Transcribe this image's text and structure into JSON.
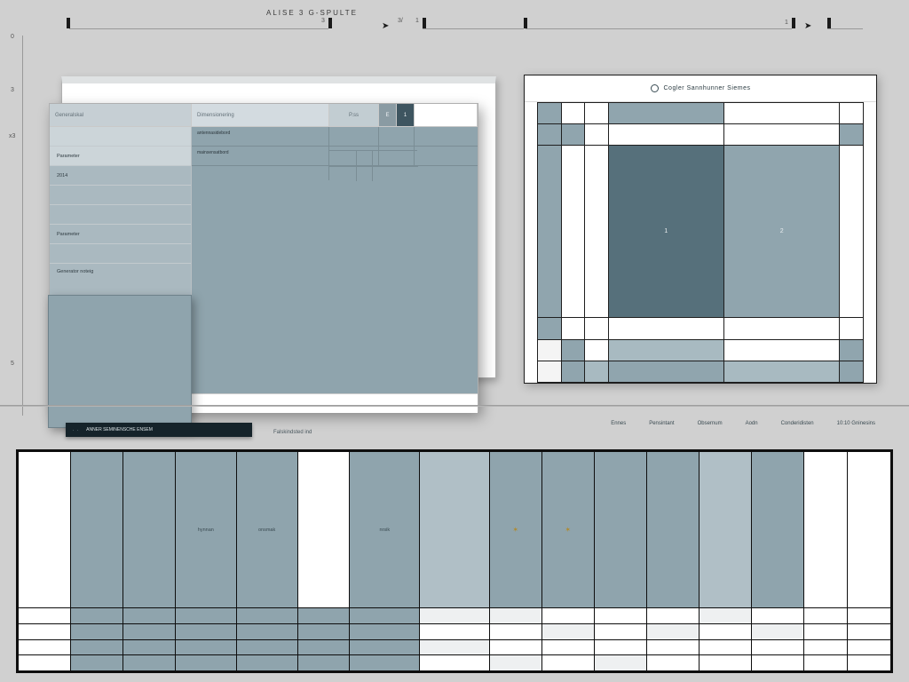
{
  "top": {
    "title": "ALISE 3 G-SPULTE",
    "axis_top_left": "3",
    "axis_top_right_a": "3/",
    "axis_top_right_b": "1",
    "axis_far_right": "1",
    "axis_y_0": "0",
    "axis_y_1": "3",
    "axis_y_2": "x3",
    "axis_y_bottom": "5"
  },
  "leftPanel": {
    "header": {
      "col1": "Generalskal",
      "col2": "Dimensionering",
      "col3": "P.ss",
      "col4": "E",
      "col5": "1"
    },
    "side": [
      "",
      "Parameter",
      "2014",
      "",
      "",
      "Parameter",
      "",
      "Generator noteig"
    ],
    "mainRow1": "antennasidebord",
    "mainRow2": "mainsensatbord"
  },
  "rightPanel": {
    "title": "Cogler Sannhunner Siemes",
    "cells": {
      "r2c4": "1",
      "r2c5": "2"
    }
  },
  "bottom": {
    "bar_prefix": ". .",
    "bar_label": "ANNER SEMINENSCHE ENSEM",
    "left_label": "Falskindsted ind",
    "mid_label": "nrsik",
    "headers": [
      "Ennes",
      "Pensintant",
      "Obsernum",
      "Aodn",
      "Conderidisten",
      "10:10 Gninesins"
    ]
  }
}
